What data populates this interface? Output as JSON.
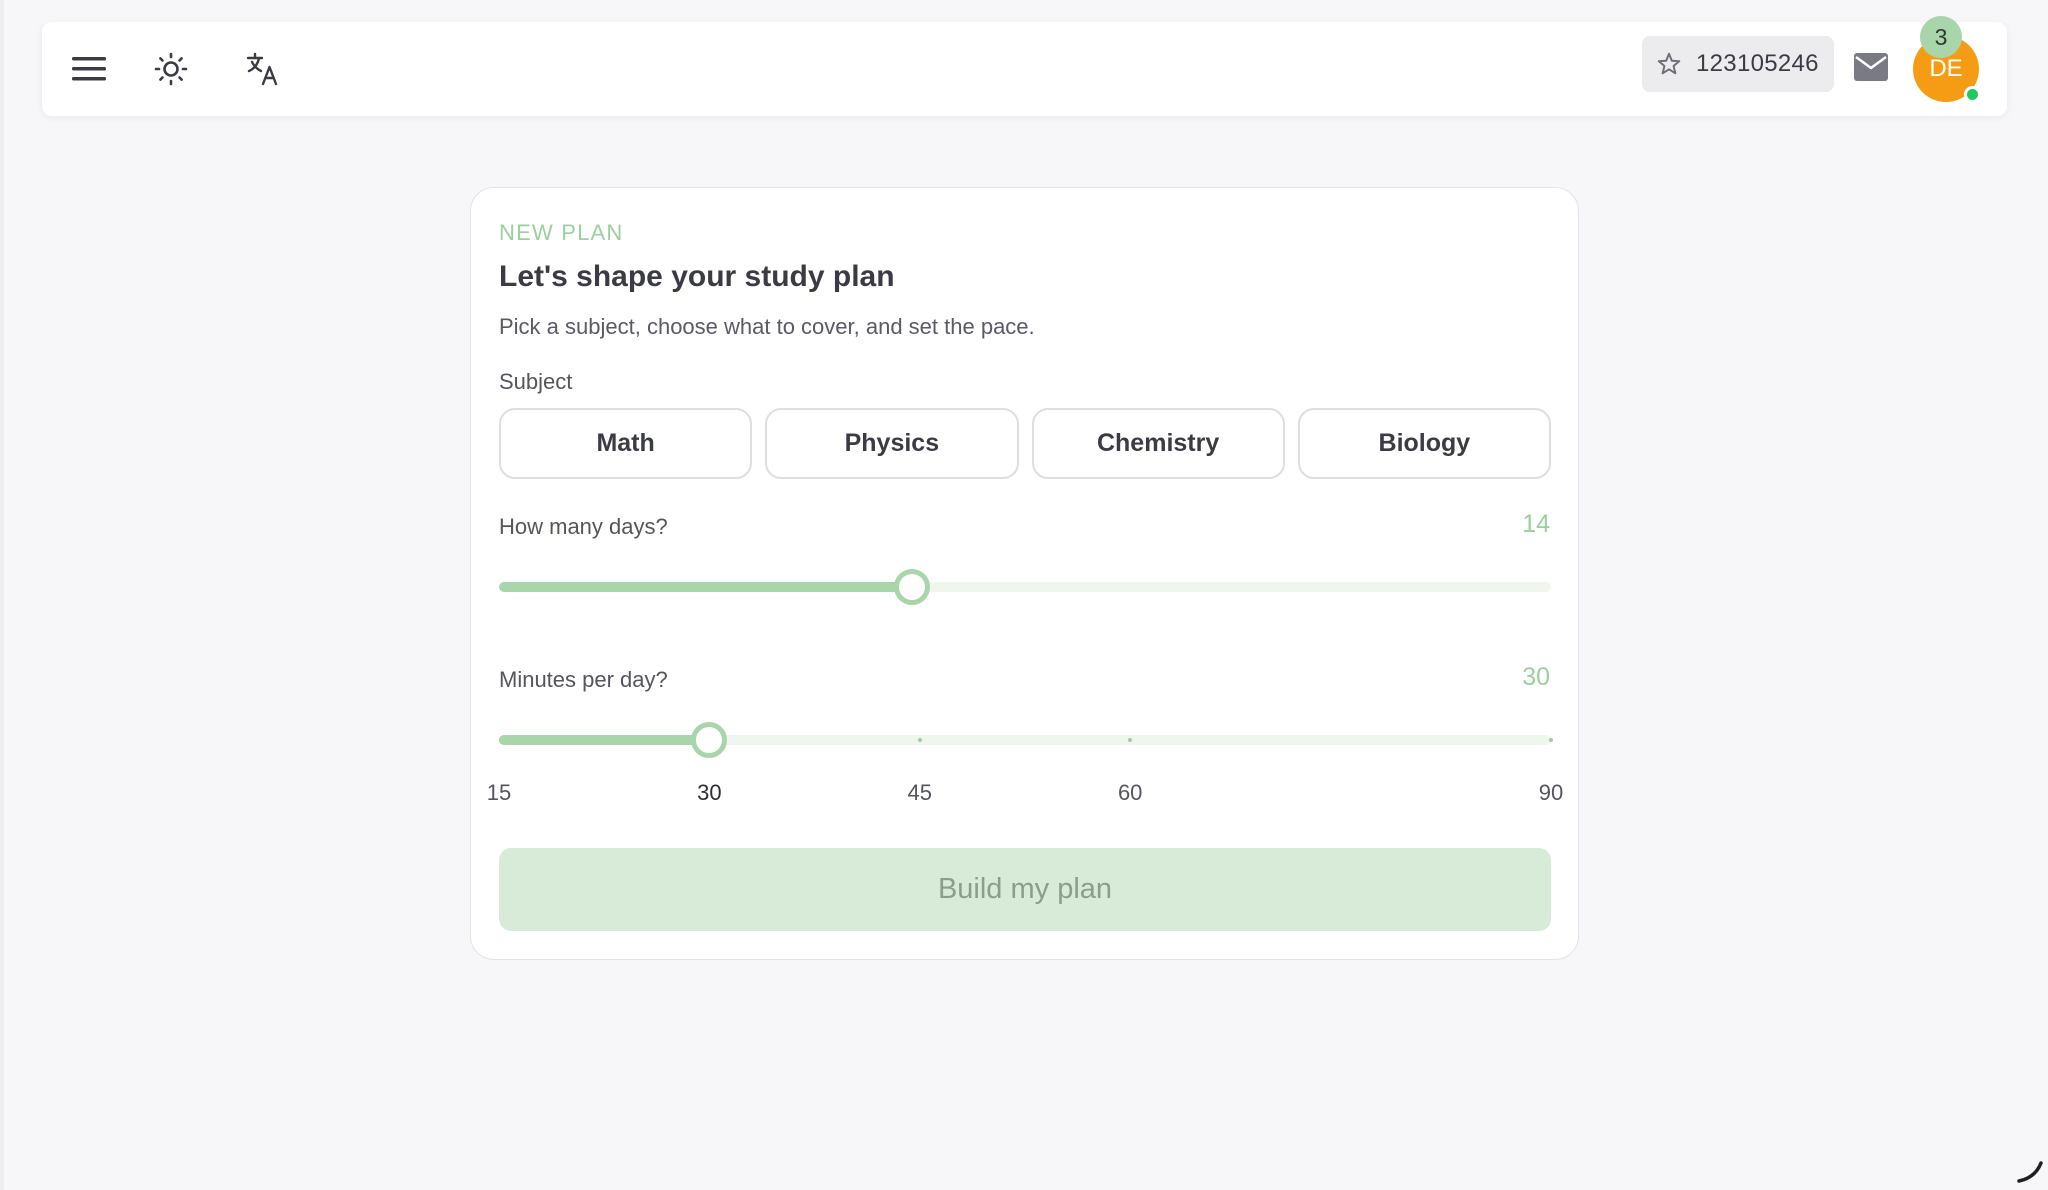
{
  "topbar": {
    "menu_icon": "hamburger-menu-icon",
    "theme_icon": "sun-icon",
    "language_icon": "translate-icon",
    "points": {
      "icon": "star-icon",
      "value": "123105246"
    },
    "mail": {
      "icon": "mail-icon",
      "unread_count": "3"
    },
    "avatar": {
      "initials": "DE",
      "color": "#f59b14",
      "status_color": "#22c55e"
    }
  },
  "card": {
    "eyebrow": "NEW PLAN",
    "title": "Let's shape your study plan",
    "subtitle": "Pick a subject, choose what to cover, and set the pace.",
    "subject_label": "Subject",
    "subjects": [
      {
        "label": "Math"
      },
      {
        "label": "Physics"
      },
      {
        "label": "Chemistry"
      },
      {
        "label": "Biology"
      }
    ],
    "days": {
      "label": "How many days?",
      "value": "14",
      "fill_fraction": 0.393
    },
    "minutes": {
      "label": "Minutes per day?",
      "value": "30",
      "min": 15,
      "max": 90,
      "marks": [
        "15",
        "30",
        "45",
        "60",
        "90"
      ]
    },
    "cta_label": "Build my plan"
  },
  "colors": {
    "accent": "#a8d5aa",
    "accent_text": "#9ccf9e",
    "cta_background": "#d8ebd9",
    "page_background": "#f7f7f9"
  }
}
